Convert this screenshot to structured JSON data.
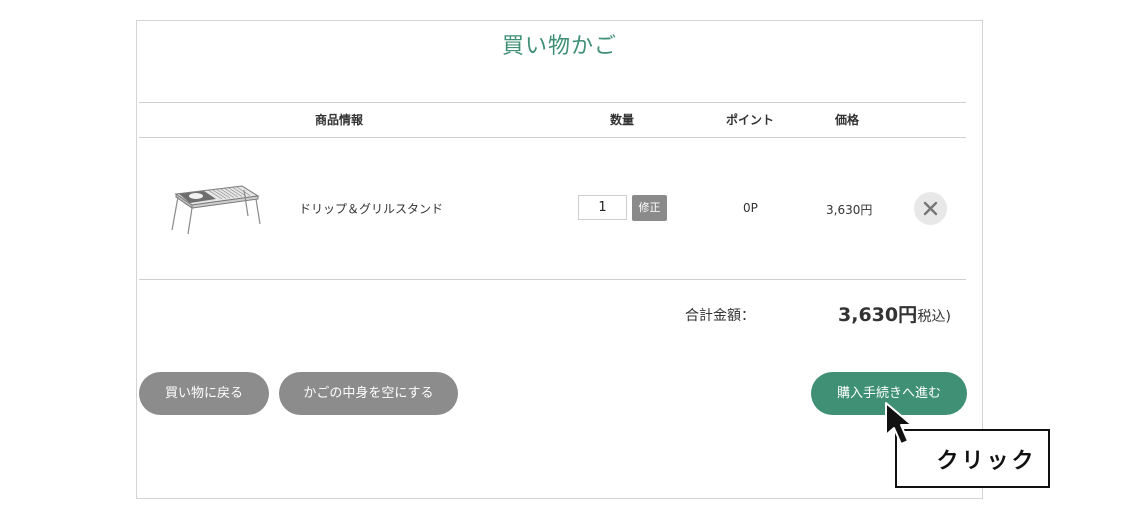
{
  "cart": {
    "title": "買い物かご",
    "columns": {
      "product": "商品情報",
      "quantity": "数量",
      "points": "ポイント",
      "price": "価格"
    },
    "items": [
      {
        "name": "ドリップ＆グリルスタンド",
        "quantity": "1",
        "update_label": "修正",
        "points": "0P",
        "price": "3,630円",
        "remove_icon": "close-icon"
      }
    ],
    "total": {
      "label": "合計金額：",
      "amount": "3,630円",
      "tax_note": "(税込)"
    },
    "buttons": {
      "back": "買い物に戻る",
      "empty": "かごの中身を空にする",
      "checkout": "購入手続きへ進む"
    }
  },
  "annotation": {
    "callout": "クリック",
    "cursor_icon": "mouse-pointer-icon"
  },
  "colors": {
    "accent": "#3f9075",
    "button_gray": "#8c8c8c"
  }
}
